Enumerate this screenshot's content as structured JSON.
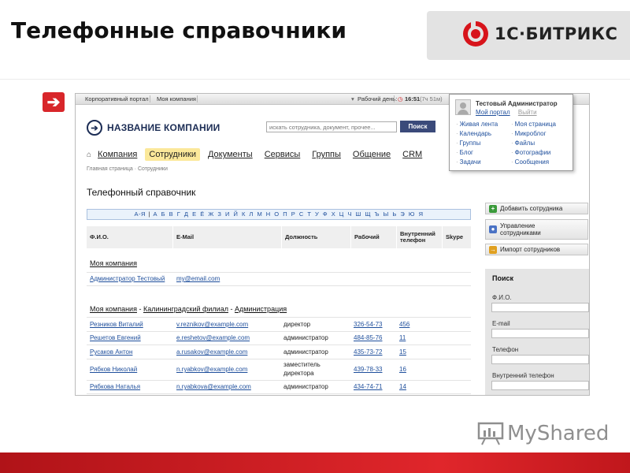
{
  "slide": {
    "title": "Телефонные справочники",
    "brand_text": "1С·БИТРИКС",
    "watermark": "MyShared",
    "accent_red": "#d8262a"
  },
  "topbar": {
    "portal": "Корпоративный портал",
    "company": "Моя компания",
    "workday": "Рабочий день:",
    "time": "16:51",
    "duration": "(7ч 51м)"
  },
  "header": {
    "company_name": "НАЗВАНИЕ КОМПАНИИ",
    "search_placeholder": "искать сотрудника, документ, прочее...",
    "search_button": "Поиск"
  },
  "nav": {
    "tabs": [
      "Компания",
      "Сотрудники",
      "Документы",
      "Сервисы",
      "Группы",
      "Общение",
      "CRM"
    ],
    "active": "Сотрудники",
    "breadcrumb": "Главная страница  ·  Сотрудники"
  },
  "user_menu": {
    "name": "Тестовый Администратор",
    "my_portal": "Мой портал",
    "logout": "Выйти",
    "left_items": [
      "Живая лента",
      "Календарь",
      "Группы",
      "Блог",
      "Задачи"
    ],
    "right_items": [
      "Моя страница",
      "Микроблог",
      "Файлы",
      "Фотографии",
      "Сообщения"
    ]
  },
  "main": {
    "heading": "Телефонный справочник",
    "alphabet": [
      "А-Я",
      "А",
      "Б",
      "В",
      "Г",
      "Д",
      "Е",
      "Ё",
      "Ж",
      "З",
      "И",
      "Й",
      "К",
      "Л",
      "М",
      "Н",
      "О",
      "П",
      "Р",
      "С",
      "Т",
      "У",
      "Ф",
      "Х",
      "Ц",
      "Ч",
      "Ш",
      "Щ",
      "Ъ",
      "Ы",
      "Ь",
      "Э",
      "Ю",
      "Я"
    ],
    "columns": [
      "Ф.И.О.",
      "E-Mail",
      "Должность",
      "Рабочий",
      "Внутренний телефон",
      "Skype"
    ],
    "group1": {
      "title": "Моя компания"
    },
    "group1_rows": [
      {
        "name": "Администратор Тестовый",
        "email": "my@email.com",
        "position": "",
        "work": "",
        "internal": ""
      }
    ],
    "group2": {
      "part1": "Моя компания",
      "part2": "Калининградский филиал",
      "part3": "Администрация",
      "sep": " - "
    },
    "group2_rows": [
      {
        "name": "Резников Виталий",
        "email": "v.reznikov@example.com",
        "position": "директор",
        "work": "326-54-73",
        "internal": "456"
      },
      {
        "name": "Решетов Евгений",
        "email": "e.reshetov@example.com",
        "position": "администратор",
        "work": "484-85-76",
        "internal": "11"
      },
      {
        "name": "Русаков Антон",
        "email": "a.rusakov@example.com",
        "position": "администратор",
        "work": "435-73-72",
        "internal": "15"
      },
      {
        "name": "Рябков Николай",
        "email": "n.ryabkov@example.com",
        "position": "заместитель директора",
        "position_line1": "заместитель",
        "position_line2": "директора",
        "work": "439-78-33",
        "internal": "16"
      },
      {
        "name": "Рябкова Наталья",
        "email": "n.ryabkova@example.com",
        "position": "администратор",
        "work": "434-74-71",
        "internal": "14"
      }
    ]
  },
  "sidebar": {
    "add_employee": "Добавить сотрудника",
    "manage_line1": "Управление",
    "manage_line2": "сотрудниками",
    "import": "Импорт сотрудников",
    "search_title": "Поиск",
    "fields": [
      "Ф.И.О.",
      "E-mail",
      "Телефон",
      "Внутренний телефон"
    ]
  }
}
